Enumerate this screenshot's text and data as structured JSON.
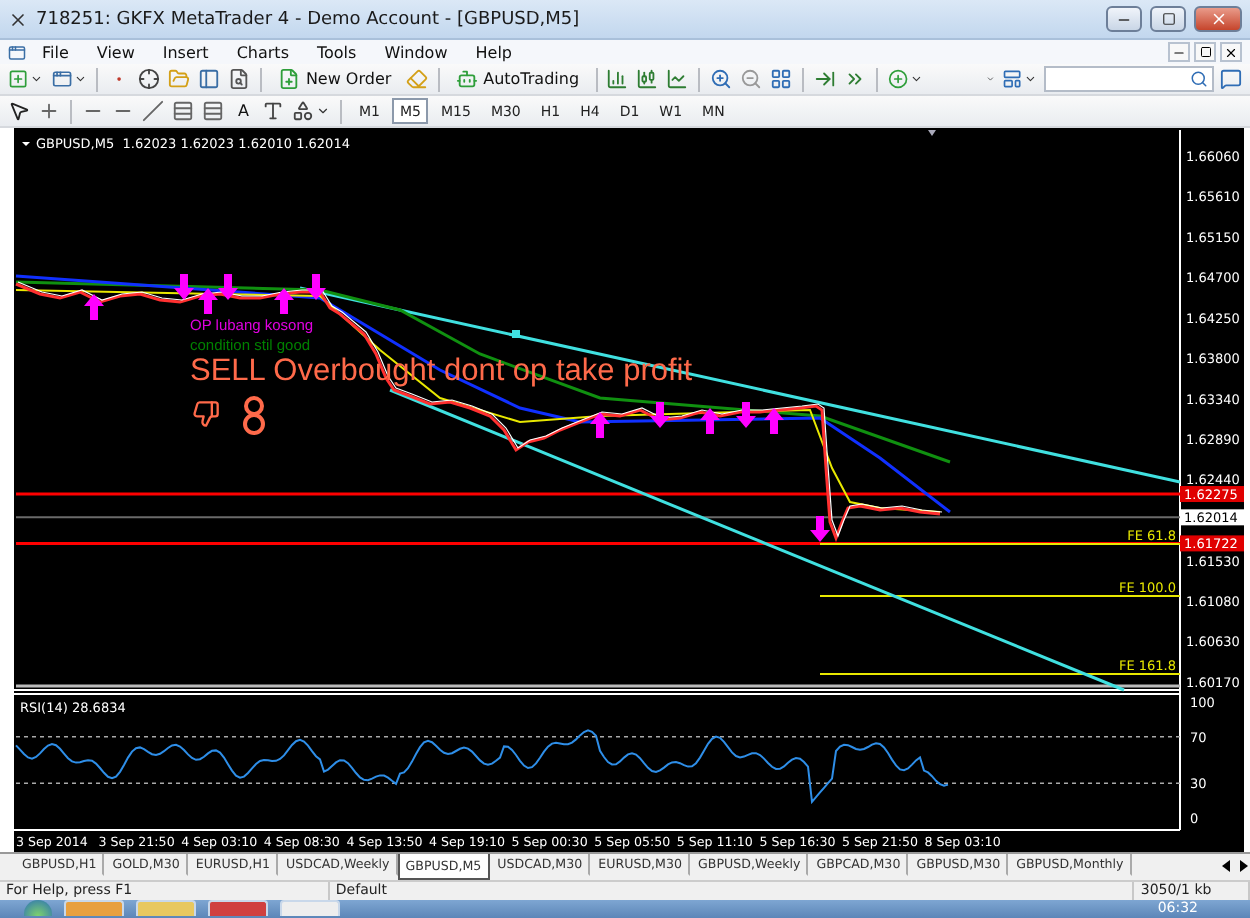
{
  "window": {
    "title": "718251: GKFX MetaTrader 4 - Demo Account - [GBPUSD,M5]"
  },
  "menu": [
    "File",
    "View",
    "Insert",
    "Charts",
    "Tools",
    "Window",
    "Help"
  ],
  "toolbar": {
    "new_order": "New Order",
    "auto_trading": "AutoTrading"
  },
  "drawing_tools": {
    "text_tool": "A"
  },
  "timeframes": [
    {
      "label": "M1",
      "selected": false
    },
    {
      "label": "M5",
      "selected": true
    },
    {
      "label": "M15",
      "selected": false
    },
    {
      "label": "M30",
      "selected": false
    },
    {
      "label": "H1",
      "selected": false
    },
    {
      "label": "H4",
      "selected": false
    },
    {
      "label": "D1",
      "selected": false
    },
    {
      "label": "W1",
      "selected": false
    },
    {
      "label": "MN",
      "selected": false
    }
  ],
  "chart": {
    "header": "GBPUSD,M5  1.62023 1.62023 1.62010 1.62014",
    "price_axis": [
      {
        "label": "1.66060",
        "kind": "tick"
      },
      {
        "label": "1.65610",
        "kind": "tick"
      },
      {
        "label": "1.65150",
        "kind": "tick"
      },
      {
        "label": "1.64700",
        "kind": "tick"
      },
      {
        "label": "1.64250",
        "kind": "tick"
      },
      {
        "label": "1.63800",
        "kind": "tick"
      },
      {
        "label": "1.63340",
        "kind": "tick"
      },
      {
        "label": "1.62890",
        "kind": "tick"
      },
      {
        "label": "1.62440",
        "kind": "tick"
      },
      {
        "label": "1.62275",
        "kind": "level"
      },
      {
        "label": "1.62014",
        "kind": "bid"
      },
      {
        "label": "1.61722",
        "kind": "level"
      },
      {
        "label": "1.61530",
        "kind": "tick"
      },
      {
        "label": "1.61080",
        "kind": "tick"
      },
      {
        "label": "1.60630",
        "kind": "tick"
      },
      {
        "label": "1.60170",
        "kind": "tick"
      }
    ],
    "annotations": [
      {
        "text": "OP lubang kosong",
        "kind": "note",
        "color": "#e000e0"
      },
      {
        "text": "condition stil good",
        "kind": "note",
        "color": "#008000"
      },
      {
        "text": "SELL Overbought dont op take profit",
        "kind": "headline",
        "color": "#ff6a4a"
      }
    ],
    "fibo_levels": [
      "FE 61.8",
      "FE 100.0",
      "FE 161.8"
    ]
  },
  "rsi": {
    "label": "RSI(14) 28.6834",
    "levels": [
      "100",
      "70",
      "30",
      "0"
    ]
  },
  "time_axis": [
    "3 Sep 2014",
    "3 Sep 21:50",
    "4 Sep 03:10",
    "4 Sep 08:30",
    "4 Sep 13:50",
    "4 Sep 19:10",
    "5 Sep 00:30",
    "5 Sep 05:50",
    "5 Sep 11:10",
    "5 Sep 16:30",
    "5 Sep 21:50",
    "8 Sep 03:10"
  ],
  "chart_tabs": [
    {
      "label": "GBPUSD,H1",
      "selected": false
    },
    {
      "label": "GOLD,M30",
      "selected": false
    },
    {
      "label": "EURUSD,H1",
      "selected": false
    },
    {
      "label": "USDCAD,Weekly",
      "selected": false
    },
    {
      "label": "GBPUSD,M5",
      "selected": true
    },
    {
      "label": "USDCAD,M30",
      "selected": false
    },
    {
      "label": "EURUSD,M30",
      "selected": false
    },
    {
      "label": "GBPUSD,Weekly",
      "selected": false
    },
    {
      "label": "GBPCAD,M30",
      "selected": false
    },
    {
      "label": "GBPUSD,M30",
      "selected": false
    },
    {
      "label": "GBPUSD,Monthly",
      "selected": false
    }
  ],
  "status_bar": [
    "For Help, press F1",
    "Default",
    "3050/1 kb"
  ],
  "taskbar": {
    "clock": "06:32"
  }
}
